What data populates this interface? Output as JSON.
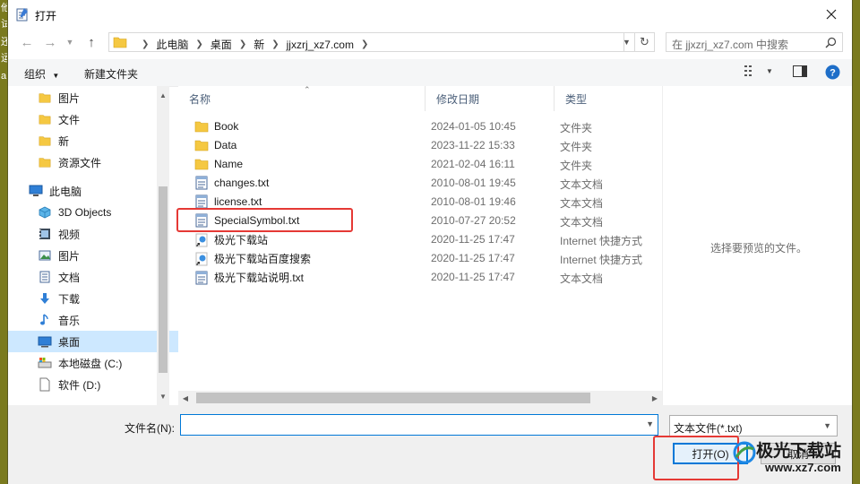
{
  "background_glyphs": [
    "他",
    "试",
    "还",
    "运",
    "a"
  ],
  "dialog": {
    "title": "打开",
    "close_label": "✕"
  },
  "address": {
    "path": [
      "此电脑",
      "桌面",
      "新",
      "jjxzrj_xz7.com"
    ],
    "search_placeholder": "在 jjxzrj_xz7.com 中搜索"
  },
  "toolbar": {
    "organize_label": "组织",
    "new_folder_label": "新建文件夹",
    "help_label": "?"
  },
  "nav": {
    "items": [
      {
        "label": "图片",
        "icon": "folder-icon"
      },
      {
        "label": "文件",
        "icon": "folder-icon"
      },
      {
        "label": "新",
        "icon": "folder-icon"
      },
      {
        "label": "资源文件",
        "icon": "folder-icon"
      },
      {
        "label": "此电脑",
        "icon": "computer-icon"
      },
      {
        "label": "3D Objects",
        "icon": "3d-objects-icon"
      },
      {
        "label": "视频",
        "icon": "video-icon"
      },
      {
        "label": "图片",
        "icon": "pictures-icon"
      },
      {
        "label": "文档",
        "icon": "documents-icon"
      },
      {
        "label": "下载",
        "icon": "download-icon"
      },
      {
        "label": "音乐",
        "icon": "music-icon"
      },
      {
        "label": "桌面",
        "icon": "desktop-icon"
      },
      {
        "label": "本地磁盘 (C:)",
        "icon": "drive-icon"
      },
      {
        "label": "软件 (D:)",
        "icon": "drive-icon"
      }
    ],
    "selected": "桌面"
  },
  "columns": {
    "name": "名称",
    "date": "修改日期",
    "type": "类型"
  },
  "files": [
    {
      "name": "Book",
      "date": "2024-01-05 10:45",
      "type": "文件夹",
      "icon": "folder-icon"
    },
    {
      "name": "Data",
      "date": "2023-11-22 15:33",
      "type": "文件夹",
      "icon": "folder-icon"
    },
    {
      "name": "Name",
      "date": "2021-02-04 16:11",
      "type": "文件夹",
      "icon": "folder-icon"
    },
    {
      "name": "changes.txt",
      "date": "2010-08-01 19:45",
      "type": "文本文档",
      "icon": "text-file-icon"
    },
    {
      "name": "license.txt",
      "date": "2010-08-01 19:46",
      "type": "文本文档",
      "icon": "text-file-icon"
    },
    {
      "name": "SpecialSymbol.txt",
      "date": "2010-07-27 20:52",
      "type": "文本文档",
      "icon": "text-file-icon"
    },
    {
      "name": "极光下载站",
      "date": "2020-11-25 17:47",
      "type": "Internet 快捷方式",
      "icon": "internet-shortcut-icon"
    },
    {
      "name": "极光下载站百度搜索",
      "date": "2020-11-25 17:47",
      "type": "Internet 快捷方式",
      "icon": "internet-shortcut-icon"
    },
    {
      "name": "极光下载站说明.txt",
      "date": "2020-11-25 17:47",
      "type": "文本文档",
      "icon": "text-file-icon"
    }
  ],
  "preview": {
    "text": "选择要预览的文件。"
  },
  "bottom": {
    "filename_label": "文件名(N):",
    "filename_value": "",
    "filetype_value": "文本文件(*.txt)",
    "open_label": "打开(O)",
    "cancel_label": "取消"
  },
  "watermark": {
    "title": "极光下载站",
    "url": "www.xz7.com"
  },
  "colors": {
    "accent": "#0078d7",
    "highlight": "#e53935",
    "folder": "#f5c842",
    "selected_nav": "#cde8ff"
  }
}
